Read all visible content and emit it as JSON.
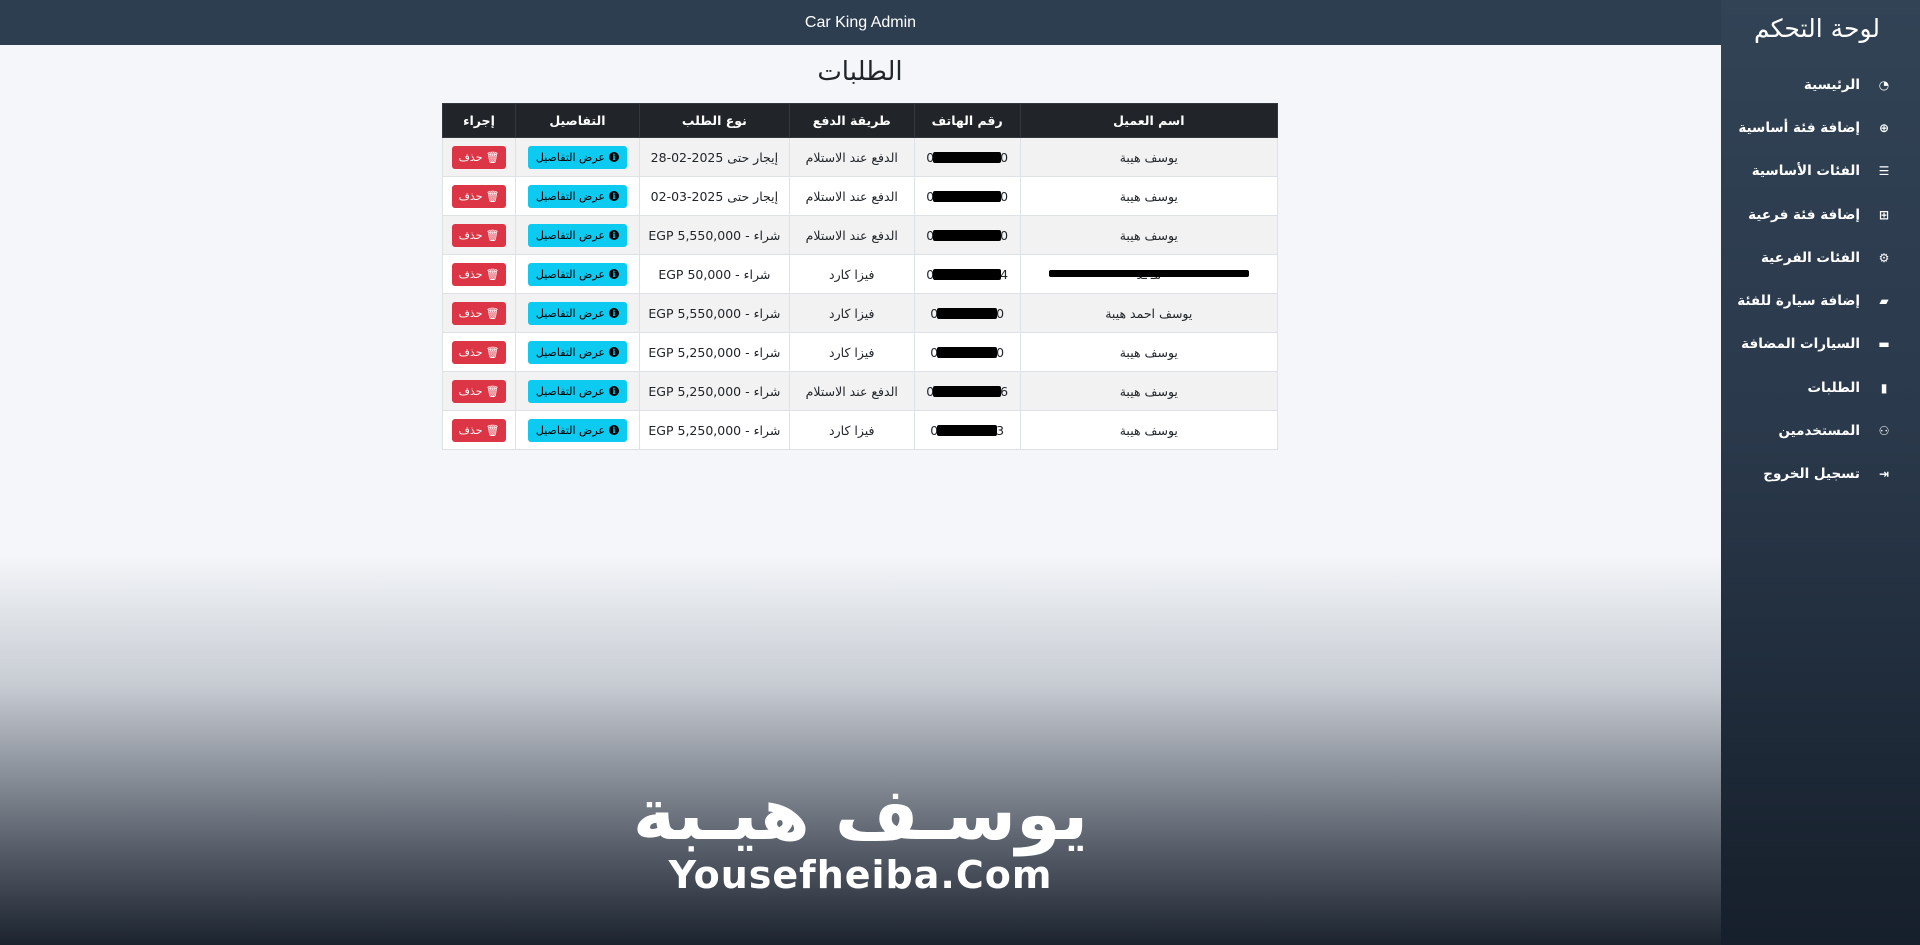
{
  "topbar": {
    "title": "Car King Admin"
  },
  "sidebar": {
    "title": "لوحة التحكم",
    "items": [
      {
        "label": "الرئيسية",
        "icon": "gauge-icon"
      },
      {
        "label": "إضافة فئة أساسية",
        "icon": "plus-circle-icon"
      },
      {
        "label": "الفئات الأساسية",
        "icon": "list-icon"
      },
      {
        "label": "إضافة فئة فرعية",
        "icon": "plus-square-icon"
      },
      {
        "label": "الفئات الفرعية",
        "icon": "cogs-icon"
      },
      {
        "label": "إضافة سيارة للفئة",
        "icon": "car-icon"
      },
      {
        "label": "السيارات المضافة",
        "icon": "car-side-icon"
      },
      {
        "label": "الطلبات",
        "icon": "bag-icon"
      },
      {
        "label": "المستخدمين",
        "icon": "users-icon"
      },
      {
        "label": "تسجيل الخروج",
        "icon": "sign-out-icon"
      }
    ]
  },
  "page": {
    "title": "الطلبات"
  },
  "table": {
    "headers": {
      "name": "اسم العميل",
      "phone": "رقم الهاتف",
      "payment": "طريقة الدفع",
      "type": "نوع الطلب",
      "details": "التفاصيل",
      "action": "إجراء"
    },
    "details_label": "عرض التفاصيل",
    "delete_label": "حذف",
    "rows": [
      {
        "name": "يوسف هيبة",
        "phone_start": "0",
        "phone_end": "20",
        "payment": "الدفع عند الاستلام",
        "type": "إيجار حتى 2025-02-28"
      },
      {
        "name": "يوسف هيبة",
        "phone_start": "0",
        "phone_end": "20",
        "payment": "الدفع عند الاستلام",
        "type": "إيجار حتى 2025-03-02"
      },
      {
        "name": "يوسف هيبة",
        "phone_start": "0",
        "phone_end": "20",
        "payment": "الدفع عند الاستلام",
        "type": "شراء - EGP 5,550,000"
      },
      {
        "name": "مـ ـد",
        "phone_start": "0",
        "phone_end": "54",
        "payment": "فيزا كارد",
        "type": "شراء - EGP 50,000",
        "redacted_name": true
      },
      {
        "name": "يوسف احمد هيبة",
        "phone_start": "0",
        "phone_end": "0",
        "payment": "فيزا كارد",
        "type": "شراء - EGP 5,550,000"
      },
      {
        "name": "يوسف هيبة",
        "phone_start": "0",
        "phone_end": "0",
        "payment": "فيزا كارد",
        "type": "شراء - EGP 5,250,000"
      },
      {
        "name": "يوسف هيبة",
        "phone_start": "0",
        "phone_end": "26",
        "payment": "الدفع عند الاستلام",
        "type": "شراء - EGP 5,250,000"
      },
      {
        "name": "يوسف هيبة",
        "phone_start": "0",
        "phone_end": "3",
        "payment": "فيزا كارد",
        "type": "شراء - EGP 5,250,000"
      }
    ]
  },
  "watermark": {
    "arabic": "يوسـف هيـبة",
    "english": "Yousefheiba.Com"
  },
  "colors": {
    "topbar": "#2e3e51",
    "header_row": "#212529",
    "info_button": "#0dcaf0",
    "danger_button": "#dc3545"
  }
}
